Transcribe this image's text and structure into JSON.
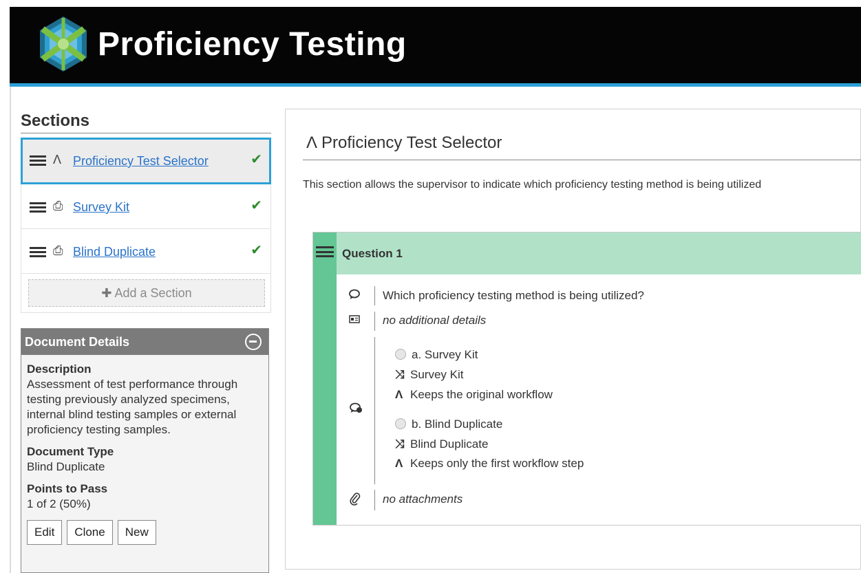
{
  "header": {
    "title": "Proficiency Testing"
  },
  "sidebar": {
    "title": "Sections",
    "items": [
      {
        "label": "Proficiency Test Selector",
        "icon": "branch-icon",
        "glyph": "Λ",
        "checked": true,
        "active": true
      },
      {
        "label": "Survey Kit",
        "icon": "document-icon",
        "glyph": "⎙",
        "checked": true,
        "active": false
      },
      {
        "label": "Blind Duplicate",
        "icon": "document-icon",
        "glyph": "⎙",
        "checked": true,
        "active": false
      }
    ],
    "add_label": "Add a Section"
  },
  "doc_details": {
    "title": "Document Details",
    "description_label": "Description",
    "description": "Assessment of test performance through testing previously analyzed specimens, internal blind testing samples or external proficiency testing samples.",
    "type_label": "Document Type",
    "type": "Blind Duplicate",
    "points_label": "Points to Pass",
    "points": "1 of 2 (50%)",
    "buttons": {
      "edit": "Edit",
      "clone": "Clone",
      "new": "New"
    }
  },
  "main": {
    "title": "Proficiency Test Selector",
    "description": "This section allows the supervisor to indicate which proficiency testing method is being utilized",
    "question": {
      "title": "Question 1",
      "text": "Which proficiency testing method is being utilized?",
      "details": "no additional details",
      "options": [
        {
          "label": "a. Survey Kit",
          "route": "Survey Kit",
          "workflow": "Keeps the original workflow"
        },
        {
          "label": "b. Blind Duplicate",
          "route": "Blind Duplicate",
          "workflow": "Keeps only the first workflow step"
        }
      ],
      "attachments": "no attachments"
    }
  },
  "colors": {
    "header_bg": "#050505",
    "header_rule": "#2b9fd6",
    "link": "#2a73c9",
    "check": "#2e8b2e",
    "question_stripe": "#63c694",
    "question_header": "#b1e2c8",
    "panel_header": "#7b7b7b"
  }
}
